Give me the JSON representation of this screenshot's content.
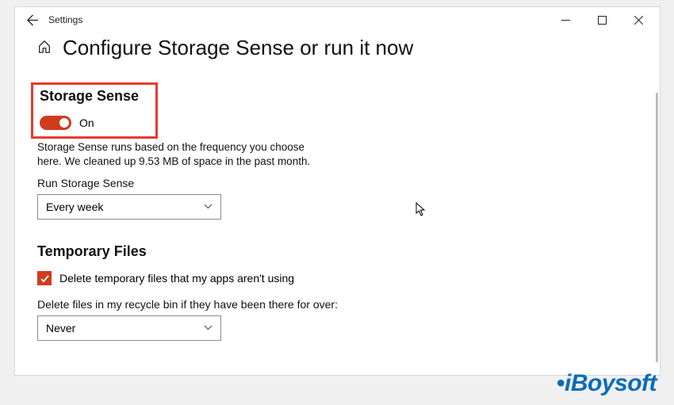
{
  "titlebar": {
    "title": "Settings"
  },
  "pageTitle": "Configure Storage Sense or run it now",
  "storageSense": {
    "heading": "Storage Sense",
    "toggleLabel": "On",
    "description": "Storage Sense runs based on the frequency you choose here. We cleaned up 9.53 MB of space in the past month.",
    "runLabel": "Run Storage Sense",
    "runValue": "Every week"
  },
  "tempFiles": {
    "heading": "Temporary Files",
    "checkboxLabel": "Delete temporary files that my apps aren't using",
    "recycleLabel": "Delete files in my recycle bin if they have been there for over:",
    "recycleValue": "Never"
  },
  "watermark": "iBoysoft"
}
